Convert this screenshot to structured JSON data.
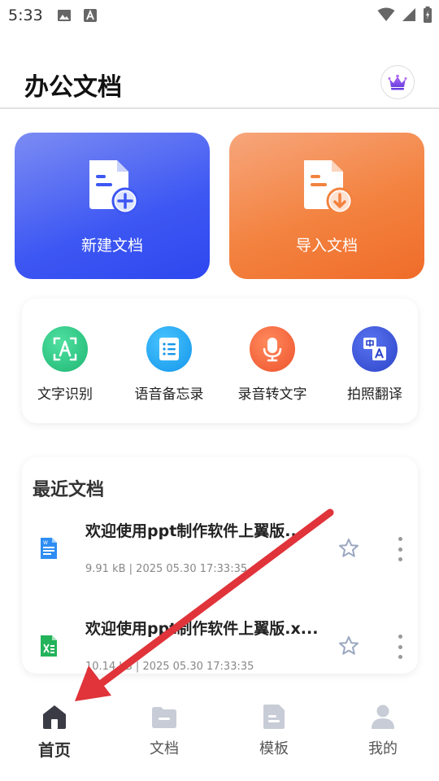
{
  "status_bar": {
    "time": "5:33",
    "left_icons": [
      "image-icon",
      "font-a-icon"
    ],
    "right_icons": [
      "wifi-icon",
      "signal-icon",
      "battery-icon"
    ]
  },
  "header": {
    "title": "办公文档",
    "vip_icon": "crown-icon"
  },
  "actions": [
    {
      "label": "新建文档",
      "icon": "document-add-icon",
      "color": "#3d57f3"
    },
    {
      "label": "导入文档",
      "icon": "document-import-icon",
      "color": "#f3823f"
    }
  ],
  "tools": [
    {
      "label": "文字识别",
      "icon": "text-scan-icon",
      "color": "#2fc783"
    },
    {
      "label": "语音备忘录",
      "icon": "memo-list-icon",
      "color": "#1e9ff0"
    },
    {
      "label": "录音转文字",
      "icon": "microphone-icon",
      "color": "#f2603a"
    },
    {
      "label": "拍照翻译",
      "icon": "translate-icon",
      "color": "#3a53d8"
    }
  ],
  "recent": {
    "title": "最近文档",
    "items": [
      {
        "name": "欢迎使用ppt制作软件上翼版...",
        "meta": "9.91 kB | 2025 05.30 17:33:35",
        "type": "word",
        "icon": "word-file-icon"
      },
      {
        "name": "欢迎使用ppt制作软件上翼版.x...",
        "meta": "10.14 kB | 2025 05.30 17:33:35",
        "type": "excel",
        "icon": "excel-file-icon"
      }
    ]
  },
  "tabs": [
    {
      "label": "首页",
      "icon": "home-icon",
      "active": true
    },
    {
      "label": "文档",
      "icon": "folder-icon",
      "active": false
    },
    {
      "label": "模板",
      "icon": "template-icon",
      "active": false
    },
    {
      "label": "我的",
      "icon": "user-icon",
      "active": false
    }
  ],
  "annotation": {
    "icon": "red-arrow-icon",
    "color": "#e0333a"
  }
}
